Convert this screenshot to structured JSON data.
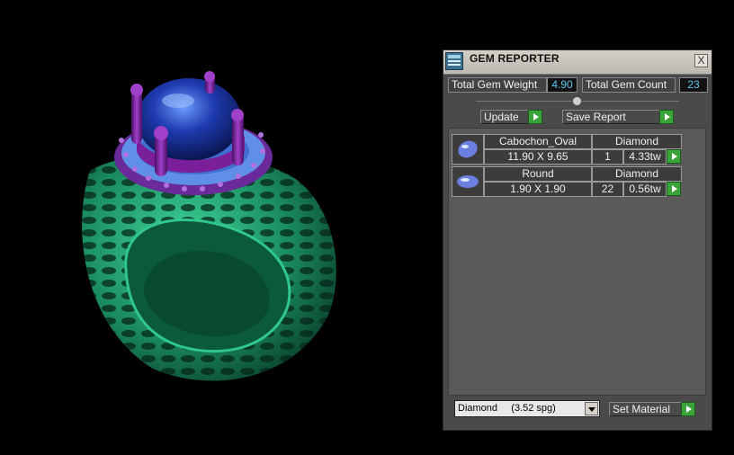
{
  "panel": {
    "title": "GEM REPORTER",
    "close_glyph": "X",
    "total_gem_weight_label": "Total Gem Weight",
    "total_gem_weight_value": "4.90",
    "total_gem_count_label": "Total Gem Count",
    "total_gem_count_value": "23",
    "update_label": "Update",
    "save_report_label": "Save Report",
    "gems": [
      {
        "cut": "Cabochon_Oval",
        "material": "Diamond",
        "size": "11.90 X 9.65",
        "count": "1",
        "weight": "4.33tw",
        "icon": "oval-gem-icon"
      },
      {
        "cut": "Round",
        "material": "Diamond",
        "size": "1.90 X 1.90",
        "count": "22",
        "weight": "0.56tw",
        "icon": "round-gem-icon"
      }
    ],
    "material_select": "Diamond     (3.52 spg)",
    "set_material_label": "Set Material"
  },
  "colors": {
    "ring_metal": "#1f9a6a",
    "center_stone": "#1f3fb0",
    "prongs": "#7a1e9a",
    "accent_stones": "#5f8fe6",
    "value_text": "#5ec8f0",
    "go_button": "#3aa33a"
  }
}
